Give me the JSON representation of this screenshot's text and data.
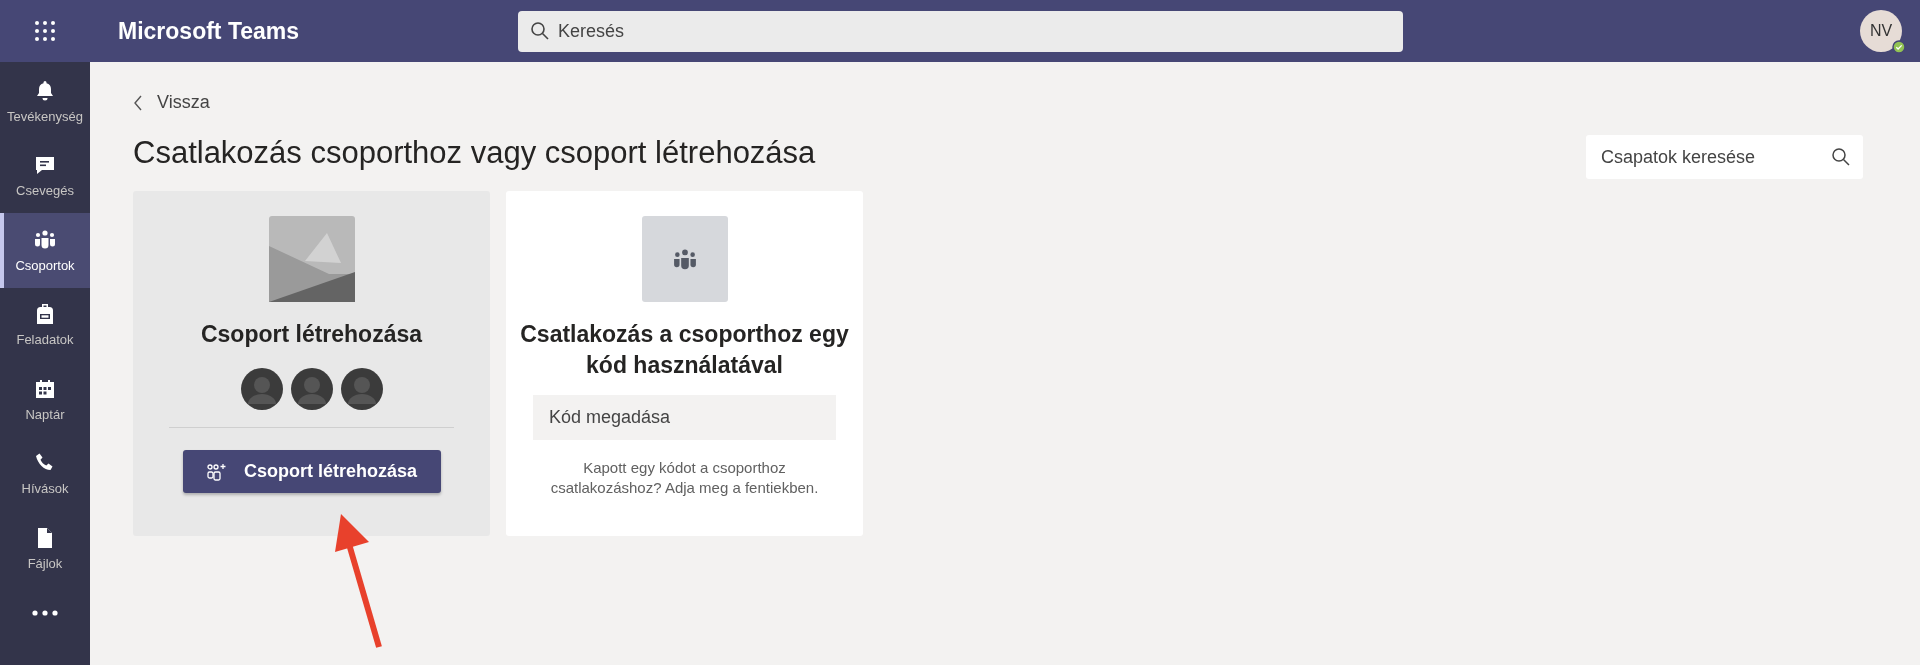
{
  "app_bar": {
    "title": "Microsoft Teams",
    "search": {
      "placeholder": "Keresés"
    },
    "avatar": {
      "initials": "NV",
      "online": true
    }
  },
  "sidebar": {
    "items": [
      {
        "kind": "activity",
        "label": "Tevékenység",
        "selected": false
      },
      {
        "kind": "chat",
        "label": "Csevegés",
        "selected": false
      },
      {
        "kind": "teams",
        "label": "Csoportok",
        "selected": true
      },
      {
        "kind": "assignments",
        "label": "Feladatok",
        "selected": false
      },
      {
        "kind": "calendar",
        "label": "Naptár",
        "selected": false
      },
      {
        "kind": "calls",
        "label": "Hívások",
        "selected": false
      },
      {
        "kind": "files",
        "label": "Fájlok",
        "selected": false
      }
    ],
    "more": true
  },
  "back_link": "Vissza",
  "page_title": "Csatlakozás csoporthoz vagy csoport létrehozása",
  "team_search": {
    "placeholder": "Csapatok keresése"
  },
  "cards": [
    {
      "kind": "create",
      "hovered": true,
      "title": "Csoport létrehozása",
      "button": "Csoport létrehozása"
    },
    {
      "kind": "join",
      "hovered": false,
      "title": "Csatlakozás a csoporthoz egy kód használatával",
      "input": {
        "placeholder": "Kód megadása"
      },
      "hint": "Kapott egy kódot a csoporthoz csatlakozáshoz? Adja meg a fentiekben."
    }
  ],
  "annotation": {
    "kind": "arrow"
  }
}
